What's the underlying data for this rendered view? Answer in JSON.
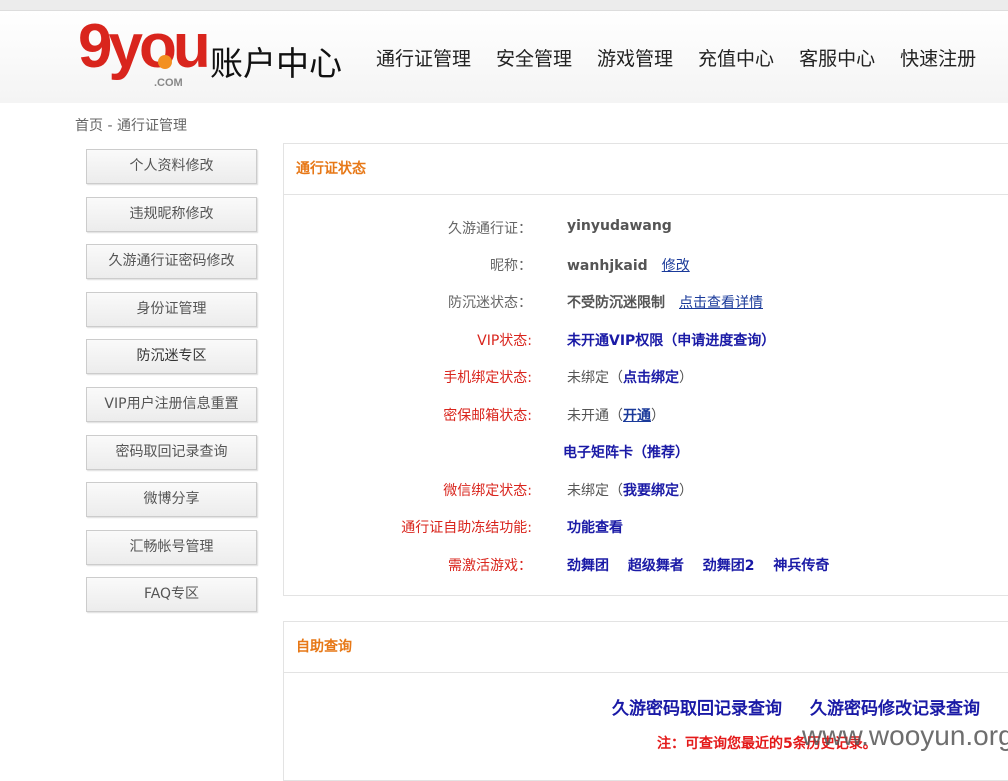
{
  "header": {
    "logo_text": "9you",
    "logo_sub": ".COM",
    "title": "账户中心",
    "nav": [
      "通行证管理",
      "安全管理",
      "游戏管理",
      "充值中心",
      "客服中心",
      "快速注册"
    ]
  },
  "breadcrumb": "首页 - 通行证管理",
  "sidebar": [
    "个人资料修改",
    "违规昵称修改",
    "久游通行证密码修改",
    "身份证管理",
    "防沉迷专区",
    "VIP用户注册信息重置",
    "密码取回记录查询",
    "微博分享",
    "汇畅帐号管理",
    "FAQ专区"
  ],
  "status": {
    "title": "通行证状态",
    "account_label": "久游通行证：",
    "account": "yinyudawang",
    "nick_label": "昵称：",
    "nick": "wanhjkaid",
    "nick_edit": "修改",
    "addict_label": "防沉迷状态：",
    "addict": "不受防沉迷限制",
    "addict_link": "点击查看详情",
    "vip_label": "VIP状态:",
    "vip": "未开通VIP权限（申请进度查询）",
    "phone_label": "手机绑定状态:",
    "phone": "未绑定（",
    "phone_link": "点击绑定",
    "phone_end": "）",
    "mail_label": "密保邮箱状态:",
    "mail": "未开通（",
    "mail_link": "开通",
    "mail_end": "）",
    "matrix": "电子矩阵卡（推荐）",
    "wechat_label": "微信绑定状态:",
    "wechat": "未绑定（",
    "wechat_link": "我要绑定",
    "wechat_end": "）",
    "freeze_label": "通行证自助冻结功能:",
    "freeze": "功能查看",
    "games_label": "需激活游戏：",
    "games": [
      "劲舞团",
      "超级舞者",
      "劲舞团2",
      "神兵传奇"
    ]
  },
  "query": {
    "title": "自助查询",
    "link1": "久游密码取回记录查询",
    "link2": "久游密码修改记录查询",
    "note": "注：可查询您最近的5条历史记录。"
  },
  "watermark": "www.wooyun.org"
}
